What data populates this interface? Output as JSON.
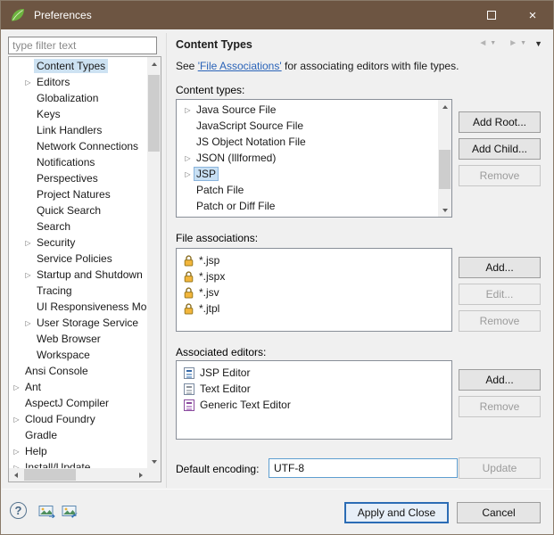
{
  "window": {
    "title": "Preferences"
  },
  "icons": {
    "app": "spring-leaf",
    "maximize": "maximize-box",
    "close": "×",
    "help": "?",
    "expand_collapsed": "▷",
    "back": "◄",
    "forward": "►",
    "dropdown": "▼",
    "lock": "padlock"
  },
  "sidebar": {
    "filter_placeholder": "type filter text",
    "tree": [
      {
        "label": "Content Types",
        "level": 1,
        "arrow": false,
        "selected": true
      },
      {
        "label": "Editors",
        "level": 1,
        "arrow": true
      },
      {
        "label": "Globalization",
        "level": 1
      },
      {
        "label": "Keys",
        "level": 1
      },
      {
        "label": "Link Handlers",
        "level": 1
      },
      {
        "label": "Network Connections",
        "level": 1
      },
      {
        "label": "Notifications",
        "level": 1
      },
      {
        "label": "Perspectives",
        "level": 1
      },
      {
        "label": "Project Natures",
        "level": 1
      },
      {
        "label": "Quick Search",
        "level": 1
      },
      {
        "label": "Search",
        "level": 1
      },
      {
        "label": "Security",
        "level": 1,
        "arrow": true
      },
      {
        "label": "Service Policies",
        "level": 1
      },
      {
        "label": "Startup and Shutdown",
        "level": 1,
        "arrow": true
      },
      {
        "label": "Tracing",
        "level": 1
      },
      {
        "label": "UI Responsiveness Monitoring",
        "level": 1
      },
      {
        "label": "User Storage Service",
        "level": 1,
        "arrow": true
      },
      {
        "label": "Web Browser",
        "level": 1
      },
      {
        "label": "Workspace",
        "level": 1
      },
      {
        "label": "Ansi Console",
        "level": 0
      },
      {
        "label": "Ant",
        "level": 0,
        "arrow": true
      },
      {
        "label": "AspectJ Compiler",
        "level": 0
      },
      {
        "label": "Cloud Foundry",
        "level": 0,
        "arrow": true
      },
      {
        "label": "Gradle",
        "level": 0
      },
      {
        "label": "Help",
        "level": 0,
        "arrow": true
      },
      {
        "label": "Install/Update",
        "level": 0,
        "arrow": true
      }
    ]
  },
  "content": {
    "page_title": "Content Types",
    "intro_prefix": "See ",
    "intro_link": "'File Associations'",
    "intro_suffix": " for associating editors with file types.",
    "content_types_label": "Content types:",
    "content_types": [
      {
        "label": "Java Source File",
        "arrow": true
      },
      {
        "label": "JavaScript Source File"
      },
      {
        "label": "JS Object Notation File"
      },
      {
        "label": "JSON (Illformed)",
        "arrow": true
      },
      {
        "label": "JSP",
        "arrow": true,
        "selected": true
      },
      {
        "label": "Patch File"
      },
      {
        "label": "Patch or Diff File"
      }
    ],
    "content_type_buttons": [
      {
        "label": "Add Root...",
        "name": "add-root-button"
      },
      {
        "label": "Add Child...",
        "name": "add-child-button"
      },
      {
        "label": "Remove",
        "name": "remove-content-type-button",
        "disabled": true
      }
    ],
    "file_assoc_label": "File associations:",
    "file_associations": [
      "*.jsp",
      "*.jspx",
      "*.jsv",
      "*.jtpl"
    ],
    "file_assoc_buttons": [
      {
        "label": "Add...",
        "name": "add-file-association-button"
      },
      {
        "label": "Edit...",
        "name": "edit-file-association-button",
        "disabled": true
      },
      {
        "label": "Remove",
        "name": "remove-file-association-button",
        "disabled": true
      }
    ],
    "editors_label": "Associated editors:",
    "editors": [
      {
        "label": "JSP Editor",
        "icon": "jsp"
      },
      {
        "label": "Text Editor",
        "icon": "text"
      },
      {
        "label": "Generic Text Editor",
        "icon": "generic"
      }
    ],
    "editor_buttons": [
      {
        "label": "Add...",
        "name": "add-editor-button"
      },
      {
        "label": "Remove",
        "name": "remove-editor-button",
        "disabled": true
      }
    ],
    "encoding_label": "Default encoding:",
    "encoding_value": "UTF-8",
    "update_button": "Update"
  },
  "footer": {
    "apply_button": "Apply and Close",
    "cancel_button": "Cancel"
  }
}
